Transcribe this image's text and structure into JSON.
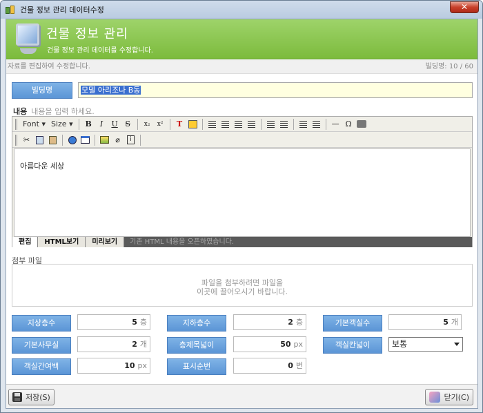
{
  "window": {
    "title": "건물 정보 관리 데이터수정",
    "close_label": "✕"
  },
  "banner": {
    "title": "건물 정보 관리",
    "subtitle": "건물 정보 관리 데이터를 수정합니다."
  },
  "info": {
    "left": "자료를 편집하여 수정합니다.",
    "right": "빌딩명: 10 / 60"
  },
  "building_name": {
    "label": "빌딩명",
    "value": "모델 아리조나 B동"
  },
  "content": {
    "label": "내용",
    "placeholder": "내용을 입력 하세요.",
    "text": "아름다운 세상"
  },
  "toolbar": {
    "font_label": "Font",
    "size_label": "Size",
    "bold": "B",
    "italic": "I",
    "underline": "U",
    "strike": "S",
    "subscript": "x₂",
    "superscript": "x²",
    "omega": "Ω",
    "hr": "—"
  },
  "mode_tabs": [
    {
      "label": "편집"
    },
    {
      "label": "HTML보기"
    },
    {
      "label": "미리보기"
    }
  ],
  "mode_note": "기존 HTML 내용을 오픈하였습니다.",
  "attachment": {
    "label": "첨부 파일",
    "hint_line1": "파일을 첨부하려면 파일을",
    "hint_line2": "이곳에 끌어오시기 바랍니다."
  },
  "fields": [
    {
      "label": "지상층수",
      "value": "5",
      "unit": "층"
    },
    {
      "label": "지하층수",
      "value": "2",
      "unit": "층"
    },
    {
      "label": "기본객실수",
      "value": "5",
      "unit": "개"
    },
    {
      "label": "기본사무실",
      "value": "2",
      "unit": "개"
    },
    {
      "label": "층제목넓이",
      "value": "50",
      "unit": "px"
    },
    {
      "label": "객실칸넓이",
      "value": "보통",
      "unit": ""
    },
    {
      "label": "객실간여백",
      "value": "10",
      "unit": "px"
    },
    {
      "label": "표시순번",
      "value": "0",
      "unit": "번"
    }
  ],
  "footer": {
    "save_label": "저장(S)",
    "close_label": "닫기(C)"
  }
}
